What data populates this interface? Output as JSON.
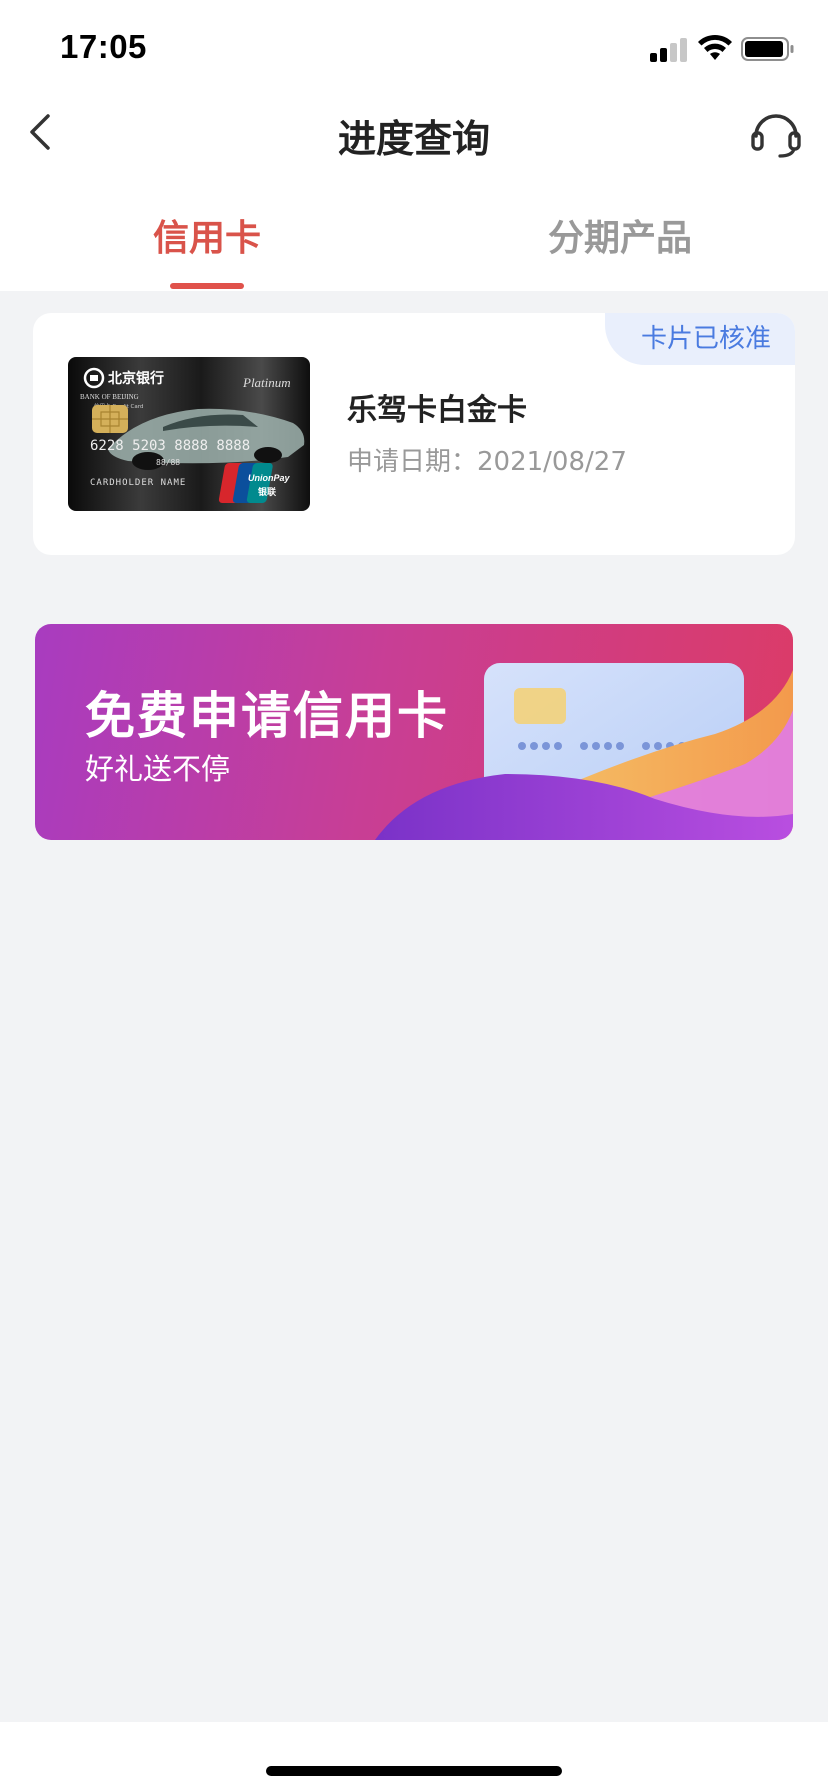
{
  "status_bar": {
    "time": "17:05"
  },
  "nav": {
    "title": "进度查询"
  },
  "tabs": [
    {
      "label": "信用卡",
      "active": true
    },
    {
      "label": "分期产品",
      "active": false
    }
  ],
  "application": {
    "status_badge": "卡片已核准",
    "card_name": "乐驾卡白金卡",
    "apply_date": "申请日期：2021/08/27",
    "card_image": {
      "bank_name": "北京银行",
      "bank_name_en": "BANK OF BEIJING",
      "card_type": "信用卡 Credit Card",
      "tier": "Platinum",
      "card_number": "6228 5203 8888 8888",
      "valid_thru": "88/88",
      "holder": "CARDHOLDER NAME",
      "network": "UnionPay",
      "network_cn": "银联"
    }
  },
  "promo": {
    "title": "免费申请信用卡",
    "subtitle": "好礼送不停"
  },
  "colors": {
    "accent": "#e0524b",
    "badge_text": "#4a7be0",
    "badge_bg": "#e9effc",
    "page_bg": "#f2f3f5"
  }
}
